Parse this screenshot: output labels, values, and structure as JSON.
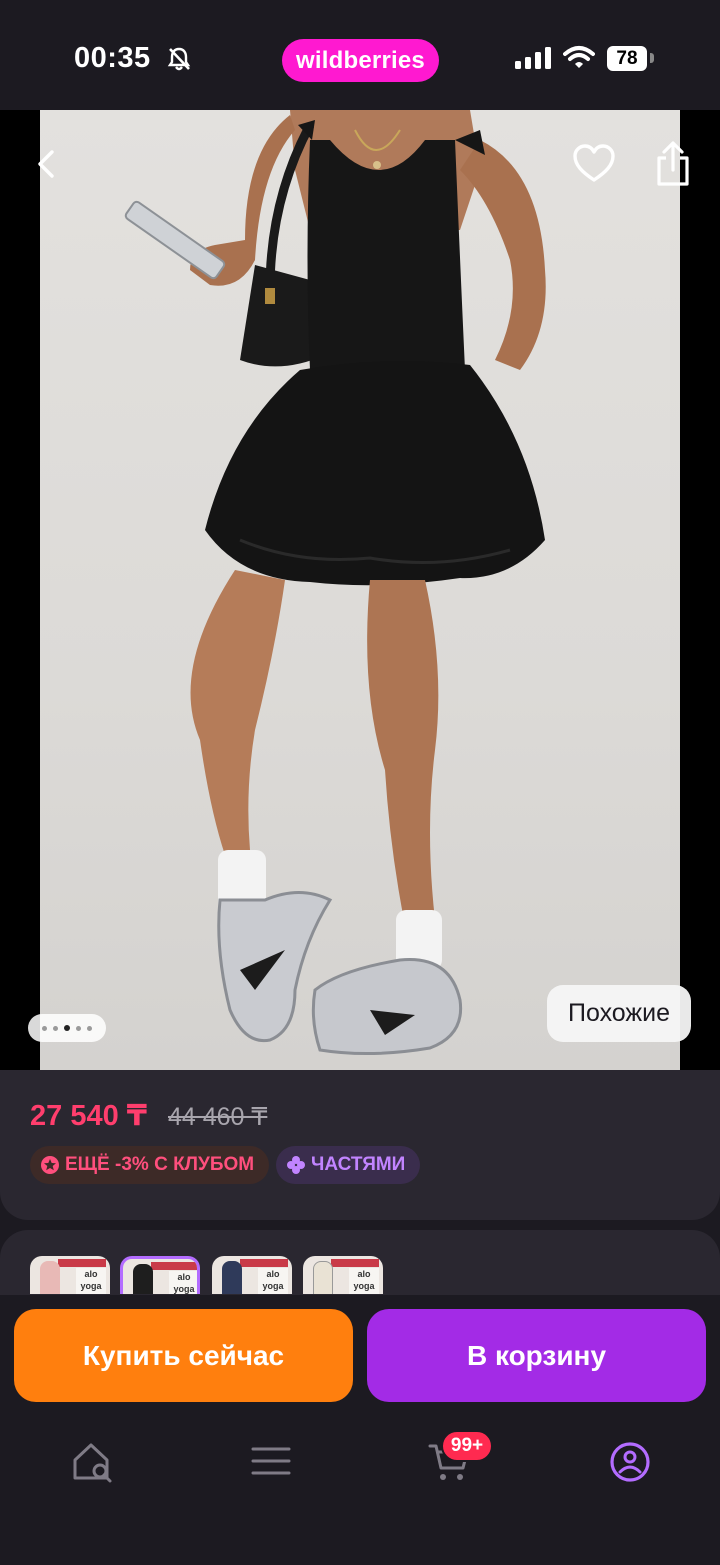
{
  "status_bar": {
    "time": "00:35",
    "brand": "wildberries",
    "battery": "78"
  },
  "photo": {
    "similar_label": "Похожие",
    "pagination_total": 5,
    "pagination_active": 2
  },
  "price": {
    "current": "27 540 ₸",
    "old": "44 460 ₸"
  },
  "badges": {
    "club": "ЕЩЁ -3% С КЛУБОМ",
    "parts": "ЧАСТЯМИ"
  },
  "variants": {
    "thumbs": [
      {
        "logo": "alo yoga",
        "color": "#e8b9b6"
      },
      {
        "logo": "alo yoga",
        "color": "#1e1e1e"
      },
      {
        "logo": "alo yoga",
        "color": "#2f3a5a"
      },
      {
        "logo": "alo yoga",
        "color": "#e9e2d4"
      }
    ]
  },
  "actions": {
    "buy_now": "Купить сейчас",
    "add_to_cart": "В корзину"
  },
  "nav": {
    "cart_badge": "99+"
  },
  "colors": {
    "brand_pink": "#ff19d0",
    "price_red": "#ff3e6d",
    "buy_orange": "#ff7f0e",
    "cart_purple": "#a32be6",
    "active_nav": "#b36cff"
  },
  "icons": [
    "bell-slash-icon",
    "signal-icon",
    "wifi-icon",
    "back-icon",
    "heart-icon",
    "share-icon",
    "star-icon",
    "clover-icon",
    "home-search-icon",
    "menu-icon",
    "cart-icon",
    "profile-icon"
  ]
}
